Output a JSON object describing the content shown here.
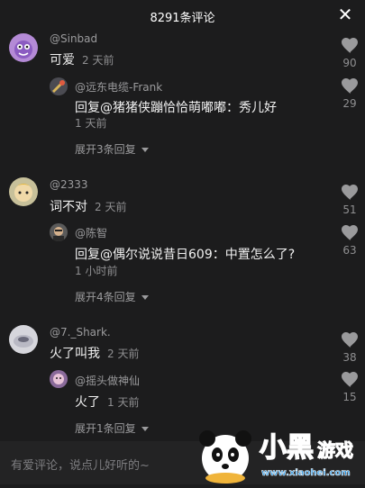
{
  "header": {
    "title": "8291条评论",
    "close_icon": "close-icon"
  },
  "comments": [
    {
      "user": "@Sinbad",
      "text": "可爱",
      "time": "2 天前",
      "likes": "90",
      "reply": {
        "user": "@远东电缆-Frank",
        "text": "回复@猪猪侠蹦恰恰萌嘟嘟：秀儿好",
        "time": "1 天前",
        "likes": "29"
      },
      "expand": "展开3条回复"
    },
    {
      "user": "@2333",
      "text": "词不对",
      "time": "2 天前",
      "likes": "51",
      "reply": {
        "user": "@陈智",
        "text": "回复@偶尔说说昔日609：中置怎么了?",
        "time": "1 小时前",
        "likes": "63"
      },
      "expand": "展开4条回复"
    },
    {
      "user": "@7._Shark.",
      "text": "火了叫我",
      "time": "2 天前",
      "likes": "38",
      "reply": {
        "user": "@摇头做神仙",
        "text": "火了",
        "time": "1 天前",
        "likes": "15"
      },
      "expand": "展开1条回复"
    }
  ],
  "input": {
    "placeholder": "有爱评论，说点儿好听的~"
  },
  "watermark": {
    "brand": "小黑游戏",
    "url": "www.xiaohei.com"
  },
  "colors": {
    "background": "#1c1c1d",
    "text": "#ffffff",
    "muted": "#9b9b9d",
    "like_icon": "#9a9a9c"
  }
}
